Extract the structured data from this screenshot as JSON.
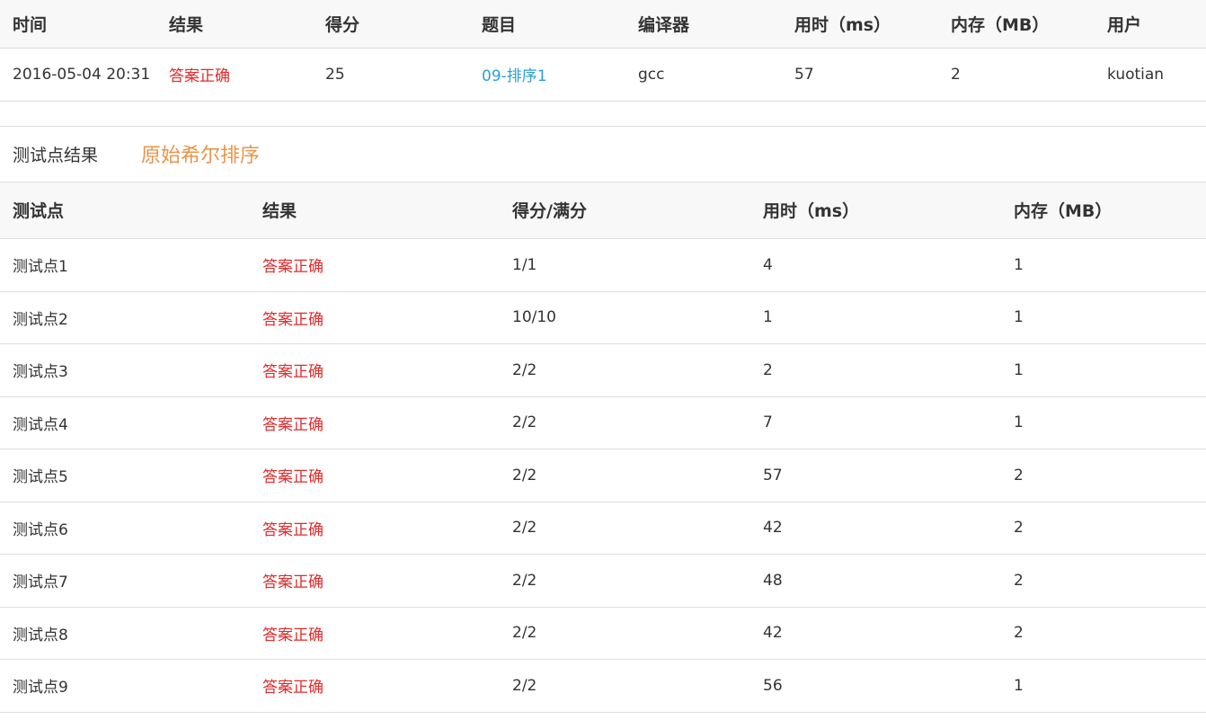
{
  "submission": {
    "headers": [
      "时间",
      "结果",
      "得分",
      "题目",
      "编译器",
      "用时（ms）",
      "内存（MB）",
      "用户"
    ],
    "row": {
      "time": "2016-05-04 20:31",
      "result": "答案正确",
      "score": "25",
      "problem": "09-排序1",
      "compiler": "gcc",
      "time_ms": "57",
      "memory_mb": "2",
      "user": "kuotian"
    }
  },
  "testcases": {
    "title": "测试点结果",
    "note": "原始希尔排序",
    "headers": [
      "测试点",
      "结果",
      "得分/满分",
      "用时（ms）",
      "内存（MB）"
    ],
    "rows": [
      {
        "name": "测试点1",
        "result": "答案正确",
        "score": "1/1",
        "time": "4",
        "memory": "1"
      },
      {
        "name": "测试点2",
        "result": "答案正确",
        "score": "10/10",
        "time": "1",
        "memory": "1"
      },
      {
        "name": "测试点3",
        "result": "答案正确",
        "score": "2/2",
        "time": "2",
        "memory": "1"
      },
      {
        "name": "测试点4",
        "result": "答案正确",
        "score": "2/2",
        "time": "7",
        "memory": "1"
      },
      {
        "name": "测试点5",
        "result": "答案正确",
        "score": "2/2",
        "time": "57",
        "memory": "2"
      },
      {
        "name": "测试点6",
        "result": "答案正确",
        "score": "2/2",
        "time": "42",
        "memory": "2"
      },
      {
        "name": "测试点7",
        "result": "答案正确",
        "score": "2/2",
        "time": "48",
        "memory": "2"
      },
      {
        "name": "测试点8",
        "result": "答案正确",
        "score": "2/2",
        "time": "42",
        "memory": "2"
      },
      {
        "name": "测试点9",
        "result": "答案正确",
        "score": "2/2",
        "time": "56",
        "memory": "1"
      }
    ]
  },
  "colors": {
    "accepted": "#e02b2b",
    "link": "#2a9fd6",
    "note": "#e8954a"
  }
}
